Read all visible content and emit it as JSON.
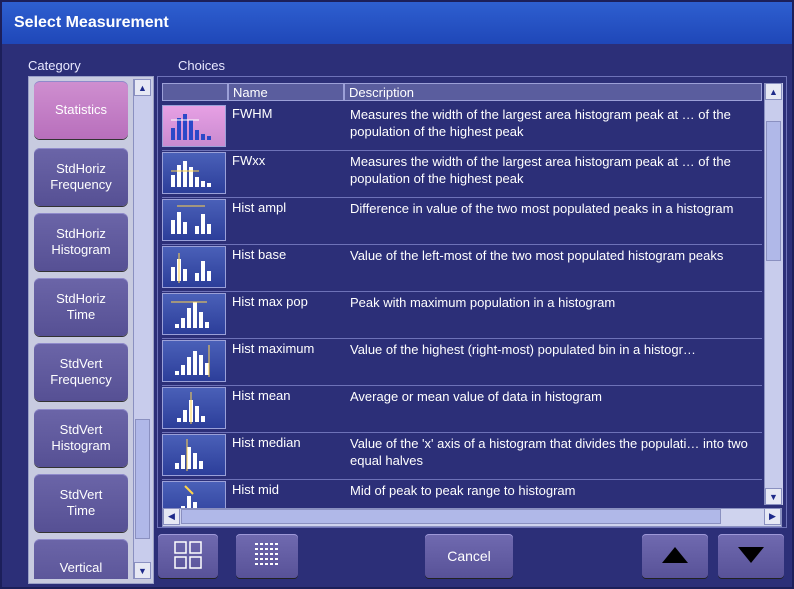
{
  "window": {
    "title": "Select Measurement"
  },
  "category": {
    "label": "Category",
    "items": [
      {
        "label": "Statistics",
        "selected": true
      },
      {
        "label": "StdHoriz\nFrequency"
      },
      {
        "label": "StdHoriz\nHistogram"
      },
      {
        "label": "StdHoriz\nTime"
      },
      {
        "label": "StdVert\nFrequency"
      },
      {
        "label": "StdVert\nHistogram"
      },
      {
        "label": "StdVert\nTime"
      },
      {
        "label": "Vertical"
      }
    ]
  },
  "choices": {
    "label": "Choices",
    "columns": {
      "icon": "",
      "name": "Name",
      "description": "Description"
    },
    "rows": [
      {
        "name": "FWHM",
        "description": "Measures the width of the largest area histogram peak at … of the population of the highest peak",
        "icon": "fwhm-icon",
        "selected": true
      },
      {
        "name": "FWxx",
        "description": "Measures the width of the largest area histogram peak at … of the population of the highest peak",
        "icon": "fwxx-icon"
      },
      {
        "name": "Hist ampl",
        "description": "Difference in value of the two most populated peaks in a histogram",
        "icon": "hist-ampl-icon"
      },
      {
        "name": "Hist base",
        "description": "Value of the left-most of the two most populated histogram peaks",
        "icon": "hist-base-icon"
      },
      {
        "name": "Hist max pop",
        "description": "Peak with maximum population in a histogram",
        "icon": "hist-max-pop-icon"
      },
      {
        "name": "Hist maximum",
        "description": "Value of the highest (right-most) populated bin in a histogr…",
        "icon": "hist-maximum-icon"
      },
      {
        "name": "Hist mean",
        "description": "Average or mean value of data in histogram",
        "icon": "hist-mean-icon"
      },
      {
        "name": "Hist median",
        "description": "Value of the 'x' axis of a histogram that divides the populati… into two equal halves",
        "icon": "hist-median-icon"
      },
      {
        "name": "Hist mid",
        "description": "Mid of peak to peak range to histogram",
        "icon": "hist-mid-icon"
      }
    ]
  },
  "footer": {
    "cancel_label": "Cancel",
    "icons": {
      "view_grid": "grid-view-icon",
      "view_list": "list-view-icon",
      "up": "up-arrow-icon",
      "down": "down-arrow-icon"
    }
  },
  "colors": {
    "title_bar": "#1f47b8",
    "background": "#2c2f78",
    "selected_category": "#b86fbc"
  }
}
